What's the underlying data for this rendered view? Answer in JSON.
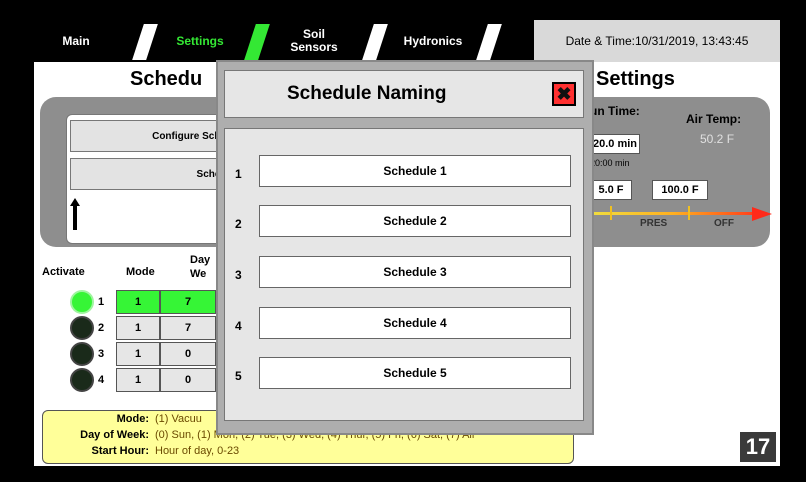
{
  "tabs": [
    {
      "label": "Main",
      "active": false
    },
    {
      "label": "Settings",
      "active": true
    },
    {
      "label": "Soil\nSensors",
      "active": false
    },
    {
      "label": "Hydronics",
      "active": false
    }
  ],
  "datetime": "Date & Time:10/31/2019, 13:43:45",
  "page": {
    "title_left": "Schedu",
    "title_right": "Settings",
    "configure_label": "Configure Schedul",
    "schedule_label": "Schedule",
    "headers": {
      "activate": "Activate",
      "mode": "Mode",
      "day_week_1": "Day",
      "day_week_2": "We"
    },
    "rows": [
      {
        "num": "1",
        "mode": "1",
        "day": "7",
        "active": true
      },
      {
        "num": "2",
        "mode": "1",
        "day": "7",
        "active": false
      },
      {
        "num": "3",
        "mode": "1",
        "day": "0",
        "active": false
      },
      {
        "num": "4",
        "mode": "1",
        "day": "0",
        "active": false
      }
    ],
    "run_time_label": "un Time:",
    "run_time_value": "20.0 min",
    "run_time_sub": "20:00 min",
    "air_temp_label": "Air Temp:",
    "air_temp_value": "50.2 F",
    "low_temp": "5.0 F",
    "high_temp": "100.0 F",
    "pres_label": "PRES",
    "off_label": "OFF",
    "legend": {
      "mode_key": "Mode:",
      "mode_val": "(1) Vacuu",
      "dow_key": "Day of Week:",
      "dow_val": "(0) Sun, (1) Mon, (2) Tue, (3) Wed, (4) Thur, (5) Fri, (6) Sat, (7) All",
      "hour_key": "Start Hour:",
      "hour_val": "Hour of day, 0-23"
    },
    "page_number": "17"
  },
  "modal": {
    "title": "Schedule Naming",
    "close_icon": "close-x-icon",
    "items": [
      {
        "num": "1",
        "name": "Schedule 1"
      },
      {
        "num": "2",
        "name": "Schedule 2"
      },
      {
        "num": "3",
        "name": "Schedule 3"
      },
      {
        "num": "4",
        "name": "Schedule 4"
      },
      {
        "num": "5",
        "name": "Schedule 5"
      }
    ]
  }
}
